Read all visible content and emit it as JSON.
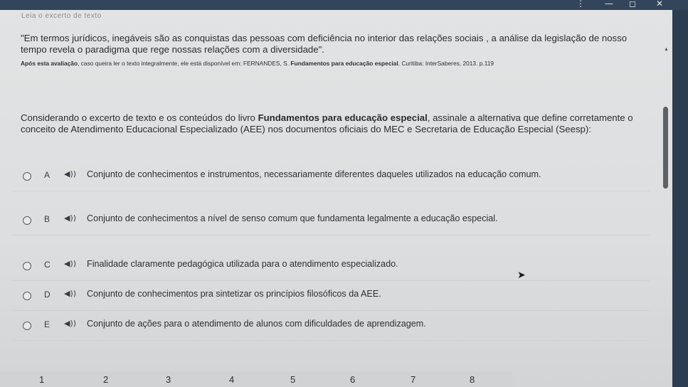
{
  "window": {
    "controls": {
      "menu": "⋮",
      "minimize": "—",
      "maximize": "◻",
      "close": "✕"
    }
  },
  "previous_heading": "Leia o excerto de texto",
  "quote": "\"Em termos jurídicos,  inegáveis são as conquistas das pessoas com deficiência no interior das relações sociais , a análise da legislação de nosso tempo revela o paradigma que rege nossas relações com a diversidade\".",
  "source": {
    "prefix": "Após esta avaliação",
    "text": ", caso queira ler o texto integralmente, ele está disponível em: FERNANDES, S. ",
    "book": "Fundamentos para educação especial",
    "suffix": ". Curitiba: InterSaberes, 2013. p.119"
  },
  "prompt": {
    "before": "Considerando o excerto de texto e os conteúdos do livro ",
    "book": "Fundamentos para educação especial",
    "after": ", assinale a alternativa que define corretamente o conceito de Atendimento Educacional Especializado (AEE) nos documentos oficiais do MEC e Secretaria de Educação Especial (Seesp):"
  },
  "options": [
    {
      "letter": "A",
      "text": "Conjunto de conhecimentos e instrumentos, necessariamente diferentes daqueles utilizados na educação comum."
    },
    {
      "letter": "B",
      "text": "Conjunto de conhecimentos a nível de senso  comum que fundamenta legalmente  a educação especial."
    },
    {
      "letter": "C",
      "text": "Finalidade claramente pedagógica utilizada para o  atendimento especializado."
    },
    {
      "letter": "D",
      "text": "Conjunto de conhecimentos pra sintetizar os princípios filosóficos da AEE."
    },
    {
      "letter": "E",
      "text": "Conjunto de ações para o atendimento de alunos com dificuldades de aprendizagem."
    }
  ],
  "speaker_glyph": "◀))",
  "pagination": [
    "1",
    "2",
    "3",
    "4",
    "5",
    "6",
    "7",
    "8"
  ],
  "colors": {
    "titlebar": "#33455a",
    "page_bg": "#dcdedf",
    "text": "#2b2d30"
  },
  "icons": {
    "speaker": "speaker-icon",
    "cursor": "mouse-cursor-icon",
    "scroll": "scroll-up-icon"
  }
}
